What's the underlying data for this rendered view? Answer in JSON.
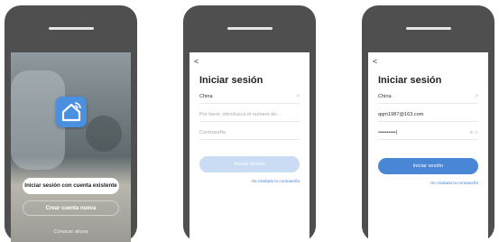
{
  "screen1": {
    "login_existing_label": "Iniciar sesión con cuenta existente",
    "create_account_label": "Crear cuenta nueva",
    "try_now_label": "Conocer ahora"
  },
  "screen2": {
    "back_glyph": "<",
    "title": "Iniciar sesión",
    "country": "China",
    "chevron_glyph": ">",
    "account_placeholder": "Por favor, introduzca el número de...",
    "password_placeholder": "Contraseña",
    "login_label": "Iniciar sesión",
    "forgot_label": "He olvidado la contraseña",
    "button_color": "#c9dcf3"
  },
  "screen3": {
    "back_glyph": "<",
    "title": "Iniciar sesión",
    "country": "China",
    "chevron_glyph": ">",
    "account_value": "qqm1987@163.com",
    "password_value": "••••••••••|",
    "field_icons": "⊗  ⊙",
    "login_label": "Iniciar sesión",
    "forgot_label": "He olvidado la contraseña",
    "button_color": "#4a86d6"
  }
}
